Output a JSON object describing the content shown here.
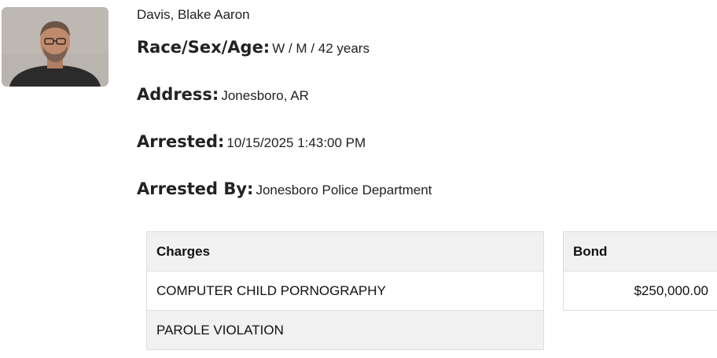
{
  "person": {
    "name": "Davis, Blake Aaron",
    "photo_icon": "mugshot-photo"
  },
  "fields": {
    "race_sex_age": {
      "label": "Race/Sex/Age:",
      "value": "W / M / 42 years"
    },
    "address": {
      "label": "Address:",
      "value": "Jonesboro, AR"
    },
    "arrested": {
      "label": "Arrested:",
      "value": "10/15/2025 1:43:00 PM"
    },
    "arrested_by": {
      "label": "Arrested By:",
      "value": "Jonesboro Police Department"
    }
  },
  "charges": {
    "header": "Charges",
    "rows": [
      "COMPUTER CHILD PORNOGRAPHY",
      "PAROLE VIOLATION"
    ]
  },
  "bond": {
    "header": "Bond",
    "rows": [
      "$250,000.00"
    ]
  }
}
